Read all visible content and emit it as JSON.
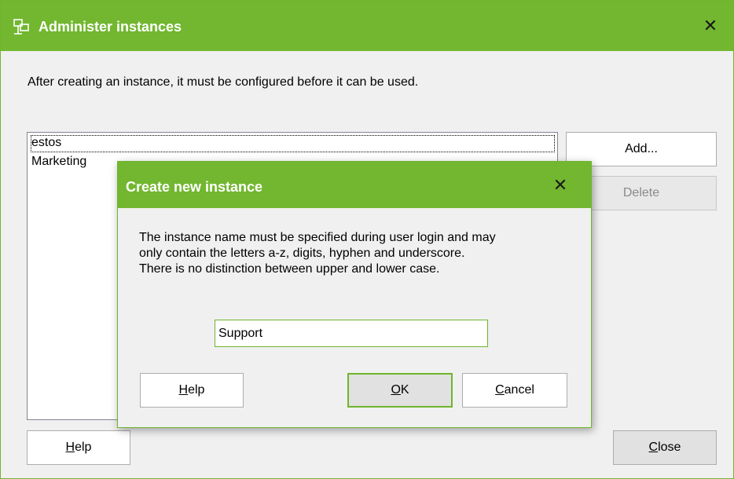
{
  "main_window": {
    "title": "Administer instances",
    "intro_text": "After creating an instance, it must be configured before it can be used.",
    "instances": [
      "estos",
      "Marketing"
    ],
    "buttons": {
      "add": "Add...",
      "delete": "Delete",
      "help_prefix": "",
      "help_mnemonic": "H",
      "help_rest": "elp",
      "close_mnemonic": "C",
      "close_rest": "lose"
    }
  },
  "dialog": {
    "title": "Create new instance",
    "message_lines": [
      "The instance name must be specified during user login and may",
      "only contain the letters a-z, digits, hyphen and underscore.",
      "There is no distinction between upper and lower case."
    ],
    "name_value": "Support",
    "buttons": {
      "help_mnemonic": "H",
      "help_rest": "elp",
      "ok_mnemonic": "O",
      "ok_rest": "K",
      "cancel_mnemonic": "C",
      "cancel_rest": "ancel"
    }
  },
  "colors": {
    "accent": "#72b72f",
    "title_text": "#ffffff"
  },
  "icons": {
    "app": "network-icon",
    "close": "close-icon"
  }
}
